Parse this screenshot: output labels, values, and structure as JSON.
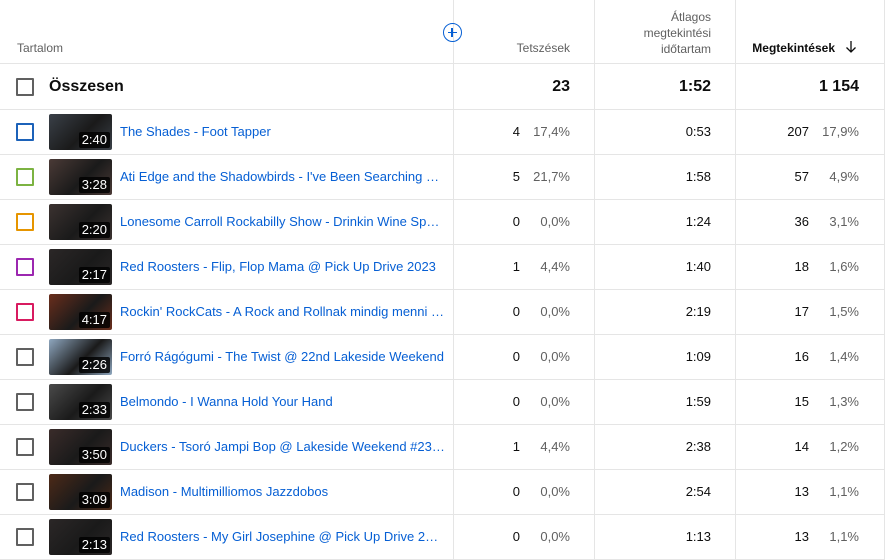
{
  "header": {
    "content_label": "Tartalom",
    "likes_label": "Tetszések",
    "avg_label_1": "Átlagos",
    "avg_label_2": "megtekintési",
    "avg_label_3": "időtartam",
    "views_label": "Megtekintések"
  },
  "total": {
    "label": "Összesen",
    "likes": "23",
    "avg": "1:52",
    "views": "1 154"
  },
  "rows": [
    {
      "title": "The Shades - Foot Tapper",
      "duration": "2:40",
      "likes": "4",
      "likes_pct": "17,4%",
      "avg": "0:53",
      "views": "207",
      "views_pct": "17,9%",
      "color": "#1c62b9",
      "thumb": "#3a4048"
    },
    {
      "title": "Ati Edge and the Shadowbirds - I've Been Searching @ …",
      "duration": "3:28",
      "likes": "5",
      "likes_pct": "21,7%",
      "avg": "1:58",
      "views": "57",
      "views_pct": "4,9%",
      "color": "#7cb342",
      "thumb": "#4a3a36"
    },
    {
      "title": "Lonesome Carroll Rockabilly Show - Drinkin Wine Spo-…",
      "duration": "2:20",
      "likes": "0",
      "likes_pct": "0,0%",
      "avg": "1:24",
      "views": "36",
      "views_pct": "3,1%",
      "color": "#e69500",
      "thumb": "#3b3230"
    },
    {
      "title": "Red Roosters - Flip, Flop Mama @ Pick Up Drive 2023",
      "duration": "2:17",
      "likes": "1",
      "likes_pct": "4,4%",
      "avg": "1:40",
      "views": "18",
      "views_pct": "1,6%",
      "color": "#9c27b0",
      "thumb": "#2b2727"
    },
    {
      "title": "Rockin' RockCats - A Rock and Rollnak mindig menni kell",
      "duration": "4:17",
      "likes": "0",
      "likes_pct": "0,0%",
      "avg": "2:19",
      "views": "17",
      "views_pct": "1,5%",
      "color": "#d81b60",
      "thumb": "#6a2e1c"
    },
    {
      "title": "Forró Rágógumi - The Twist @ 22nd Lakeside Weekend",
      "duration": "2:26",
      "likes": "0",
      "likes_pct": "0,0%",
      "avg": "1:09",
      "views": "16",
      "views_pct": "1,4%",
      "color": "#606060",
      "thumb": "#8fa7bf"
    },
    {
      "title": "Belmondo - I Wanna Hold Your Hand",
      "duration": "2:33",
      "likes": "0",
      "likes_pct": "0,0%",
      "avg": "1:59",
      "views": "15",
      "views_pct": "1,3%",
      "color": "#606060",
      "thumb": "#4a4a4a"
    },
    {
      "title": "Duckers - Tsoró Jampi Bop @ Lakeside Weekend #23, …",
      "duration": "3:50",
      "likes": "1",
      "likes_pct": "4,4%",
      "avg": "2:38",
      "views": "14",
      "views_pct": "1,2%",
      "color": "#606060",
      "thumb": "#3a2c2a"
    },
    {
      "title": "Madison - Multimilliomos Jazzdobos",
      "duration": "3:09",
      "likes": "0",
      "likes_pct": "0,0%",
      "avg": "2:54",
      "views": "13",
      "views_pct": "1,1%",
      "color": "#606060",
      "thumb": "#4d2a18"
    },
    {
      "title": "Red Roosters - My Girl Josephine @ Pick Up Drive 2023",
      "duration": "2:13",
      "likes": "0",
      "likes_pct": "0,0%",
      "avg": "1:13",
      "views": "13",
      "views_pct": "1,1%",
      "color": "#606060",
      "thumb": "#2b2727"
    }
  ]
}
